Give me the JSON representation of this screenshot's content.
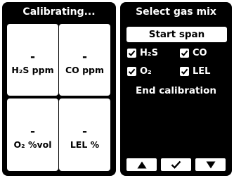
{
  "left": {
    "title": "Calibrating...",
    "tiles": [
      {
        "value": "-",
        "label": "H₂S ppm"
      },
      {
        "value": "-",
        "label": "CO ppm"
      },
      {
        "value": "-",
        "label": "O₂ %vol"
      },
      {
        "value": "-",
        "label": "LEL %"
      }
    ]
  },
  "right": {
    "title": "Select gas mix",
    "start_span_label": "Start span",
    "gases": [
      {
        "label": "H₂S",
        "checked": true
      },
      {
        "label": "CO",
        "checked": true
      },
      {
        "label": "O₂",
        "checked": true
      },
      {
        "label": "LEL",
        "checked": true
      }
    ],
    "end_calibration_label": "End calibration"
  },
  "nav": {
    "up_icon": "triangle-up",
    "confirm_icon": "checkmark",
    "down_icon": "triangle-down"
  }
}
